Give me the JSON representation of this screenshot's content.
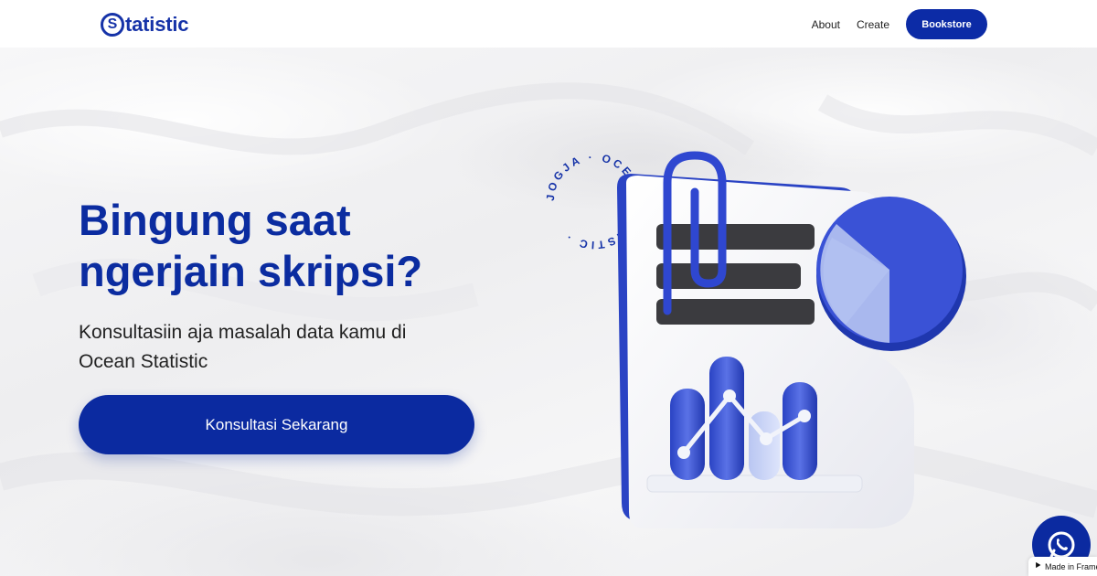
{
  "header": {
    "logo_letter": "S",
    "logo_text": "tatistic",
    "nav": {
      "about": "About",
      "create": "Create",
      "bookstore": "Bookstore"
    }
  },
  "hero": {
    "title_line1": "Bingung saat",
    "title_line2": "ngerjain skripsi?",
    "subtitle_line1": "Konsultasiin aja masalah data kamu di",
    "subtitle_line2": "Ocean Statistic",
    "cta_label": "Konsultasi Sekarang"
  },
  "badge_text": "JOGJA · OCEANSTATISTIC ·",
  "framer_badge": "Made in Framer",
  "colors": {
    "primary": "#0b2aa0",
    "text": "#222222",
    "background": "#f3f3f4"
  },
  "icons": {
    "whatsapp": "whatsapp-icon",
    "framer": "framer-icon"
  }
}
